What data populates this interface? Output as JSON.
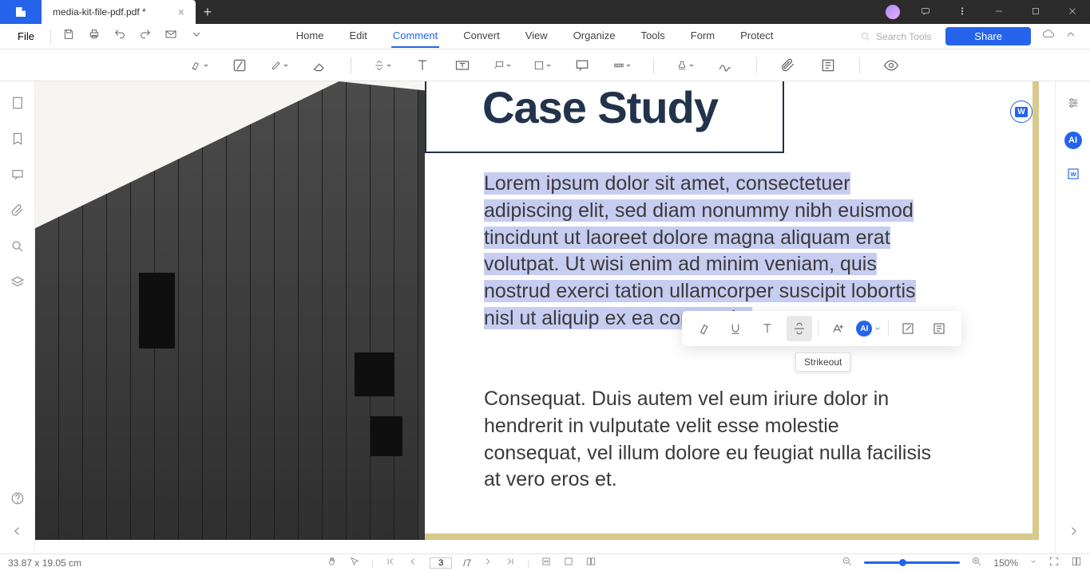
{
  "titlebar": {
    "tab_name": "media-kit-file-pdf.pdf *"
  },
  "menubar": {
    "file": "File",
    "items": [
      "Home",
      "Edit",
      "Comment",
      "Convert",
      "View",
      "Organize",
      "Tools",
      "Form",
      "Protect"
    ],
    "active_index": 2,
    "search_placeholder": "Search Tools",
    "share": "Share"
  },
  "ribbon_icons": [
    "highlight",
    "area-highlight",
    "pencil",
    "eraser",
    "strikethrough",
    "text",
    "text-box",
    "callout",
    "note",
    "text-comment",
    "measure",
    "stamp",
    "signature",
    "attachment",
    "link",
    "show-comments"
  ],
  "sidebar_left": [
    "thumbnails",
    "bookmarks",
    "comments",
    "attachments",
    "search",
    "layers"
  ],
  "sidebar_right": [
    "settings-sliders",
    "ai",
    "word-export"
  ],
  "document": {
    "heading": "Case Study",
    "para1": "Lorem ipsum dolor sit amet, consectetuer adipiscing elit, sed diam nonummy nibh euismod tincidunt ut laoreet dolore magna aliquam erat volutpat. Ut wisi enim ad minim veniam, quis nostrud exerci tation ullamcorper suscipit lobortis nisl ut aliquip ex ea commodo.",
    "para2": "Consequat. Duis autem vel eum iriure dolor in hendrerit in vulputate velit esse molestie consequat, vel illum dolore eu feugiat nulla facilisis at vero eros et."
  },
  "selection_toolbar": {
    "buttons": [
      "highlight",
      "underline",
      "caret",
      "strikeout",
      "text-add",
      "ai",
      "edit",
      "copy"
    ],
    "active": "strikeout",
    "tooltip": "Strikeout"
  },
  "statusbar": {
    "dimensions": "33.87 x 19.05 cm",
    "page_current": "3",
    "page_total": "/7",
    "zoom": "150%"
  }
}
